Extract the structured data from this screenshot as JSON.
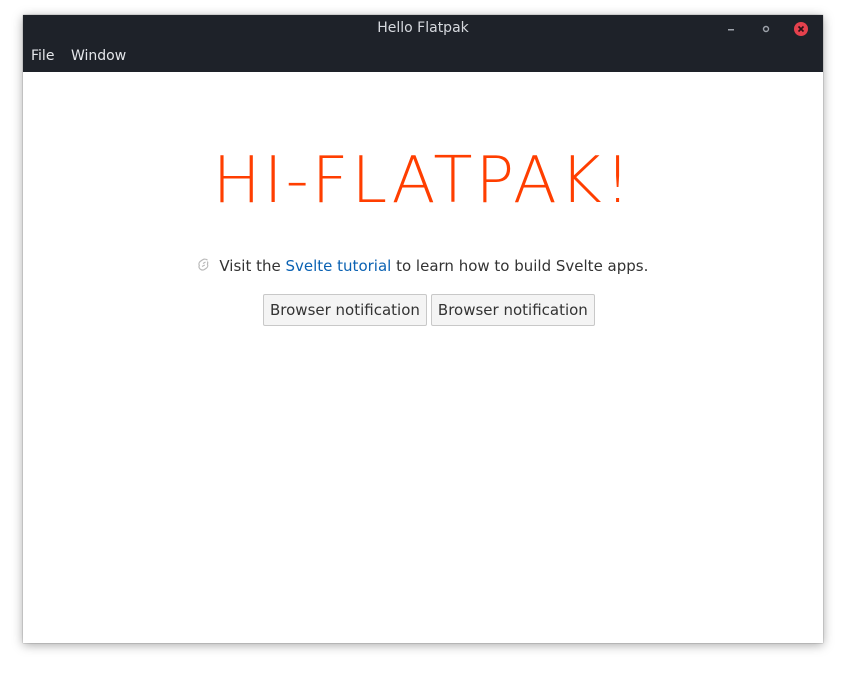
{
  "window": {
    "title": "Hello Flatpak"
  },
  "menubar": {
    "items": [
      {
        "label": "File"
      },
      {
        "label": "Window"
      }
    ]
  },
  "main": {
    "heading": "HI-FLATPAK!",
    "tip": {
      "prefix": "Visit the ",
      "link": "Svelte tutorial",
      "suffix": " to learn how to build Svelte apps."
    },
    "buttons": [
      {
        "label": "Browser notification"
      },
      {
        "label": "Browser notification"
      }
    ]
  },
  "colors": {
    "titlebar": "#1e2229",
    "accent": "#ff3e00",
    "link": "#0b62b3",
    "close": "#e5414d"
  },
  "icons": {
    "tip": "svelte-logo-icon",
    "minimize": "minimize-icon",
    "maximize": "maximize-icon",
    "close": "close-icon"
  }
}
